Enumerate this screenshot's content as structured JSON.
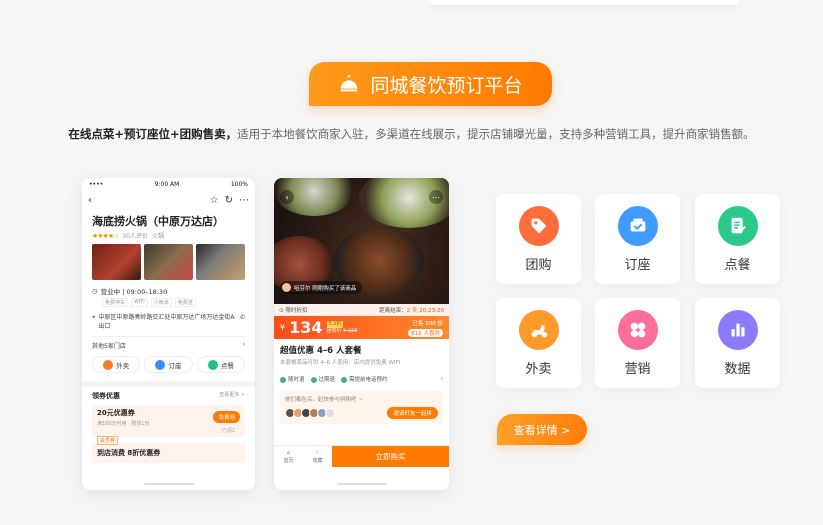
{
  "banner": {
    "title": "同城餐饮预订平台",
    "icon": "cloche-icon"
  },
  "tagline": {
    "bold": "在线点菜+预订座位+团购售卖，",
    "rest": "适用于本地餐饮商家入驻，多渠道在线展示，提示店铺曝光量，支持多种营销工具，提升商家销售额。"
  },
  "phone1": {
    "status": {
      "signal": "•••• ",
      "time": "9:00 AM",
      "battery": "100%"
    },
    "store_name": "海底捞火锅（中原万达店）",
    "stars": "★★★★☆",
    "reviews": "30人评价",
    "category": "火锅",
    "hours": "营业中 | 09:00–18:30",
    "facilities": [
      "免费停车",
      "WIFI",
      "小雨沫",
      "免费送"
    ],
    "address": "中原区中原路奏岭路交汇处中原万达广场万达金街A出口",
    "other_stores": "其他5家门店",
    "services": [
      {
        "label": "外卖",
        "color": "#ff7a2a"
      },
      {
        "label": "订座",
        "color": "#3b8cff"
      },
      {
        "label": "点餐",
        "color": "#1fbf82"
      }
    ],
    "coupon_header": "领券优惠",
    "coupon_more": "查看更多 >",
    "coupon": {
      "title": "20元优惠券",
      "cond": "满100元可用 · 限领1份",
      "tag": "会员券",
      "btn": "免费领",
      "remain": "已领2"
    },
    "coupon2_title": "到店消费 8折优惠券"
  },
  "phone2": {
    "ticker": "咀芬尔 刚刚购买了该商品",
    "limit": "限时折扣",
    "countdown_label": "距离结束：",
    "countdown": "2 天 20:23:20",
    "price": "134",
    "price_tag": "5.2折",
    "orig_label": "团购价",
    "orig_price": "¥ 168",
    "sold": "已售 500 份",
    "buyers": "816 人喜欢",
    "deal_title": "超值优惠 4–6 人套餐",
    "deal_desc": "本套餐菜品可供 4–6 人使用，店内提供免费 WIFI",
    "features": [
      "随时退",
      "过期退",
      "需提前电话预约"
    ],
    "invite_q": "他们都在买，赶快参与拼购吧 ~",
    "invite_btn": "邀请好友一起拼",
    "nav": [
      "首页",
      "收藏"
    ],
    "buy": "立即购买"
  },
  "features": [
    {
      "label": "团购",
      "color": "#ff6e3a",
      "icon": "tag-icon"
    },
    {
      "label": "订座",
      "color": "#3f9bff",
      "icon": "seat-icon"
    },
    {
      "label": "点餐",
      "color": "#2bc98c",
      "icon": "menu-icon"
    },
    {
      "label": "外卖",
      "color": "#ff9a2a",
      "icon": "delivery-icon"
    },
    {
      "label": "营销",
      "color": "#ff6d9a",
      "icon": "clover-icon"
    },
    {
      "label": "数据",
      "color": "#8a7bff",
      "icon": "bar-chart-icon"
    }
  ],
  "detail_button": "查看详情 >"
}
